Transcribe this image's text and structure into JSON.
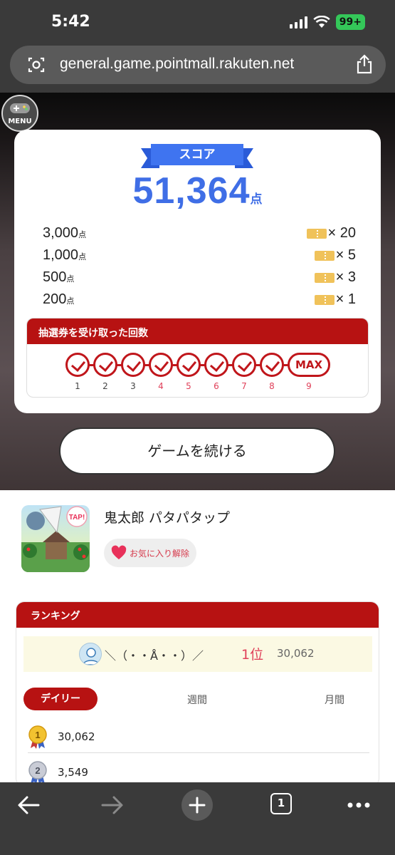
{
  "status_bar": {
    "time": "5:42",
    "battery": "99+"
  },
  "browser": {
    "url": "general.game.pointmall.rakuten.net"
  },
  "game_menu": {
    "label": "MENU"
  },
  "score": {
    "ribbon_label": "スコア",
    "value": "51,364",
    "unit": "点",
    "rewards": [
      {
        "points": "3,000",
        "unit": "点",
        "tickets": "× 20"
      },
      {
        "points": "1,000",
        "unit": "点",
        "tickets": "× 5"
      },
      {
        "points": "500",
        "unit": "点",
        "tickets": "× 3"
      },
      {
        "points": "200",
        "unit": "点",
        "tickets": "× 1"
      }
    ]
  },
  "lottery": {
    "title": "抽選券を受け取った回数",
    "steps": [
      "1",
      "2",
      "3",
      "4",
      "5",
      "6",
      "7",
      "8",
      "9"
    ],
    "checked_count": 8,
    "max_label": "MAX"
  },
  "continue_button": "ゲームを続ける",
  "game": {
    "title": "鬼太郎 パタパタップ",
    "favorite_label": "お気に入り解除",
    "icon_badge": "TAP!"
  },
  "ranking": {
    "title": "ランキング",
    "me": {
      "name": "＼（・・Å・・）／",
      "position": "1位",
      "score": "30,062"
    },
    "tabs": {
      "daily": "デイリー",
      "weekly": "週間",
      "monthly": "月間"
    },
    "rows": [
      {
        "rank": "1",
        "score": "30,062"
      },
      {
        "rank": "2",
        "score": "3,549"
      }
    ]
  },
  "toolbar": {
    "tabs_count": "1"
  },
  "colors": {
    "accent_red": "#b71212",
    "score_blue": "#3f6ee6",
    "ticket_gold": "#f0c25a",
    "favorite_pink": "#e8315a"
  }
}
